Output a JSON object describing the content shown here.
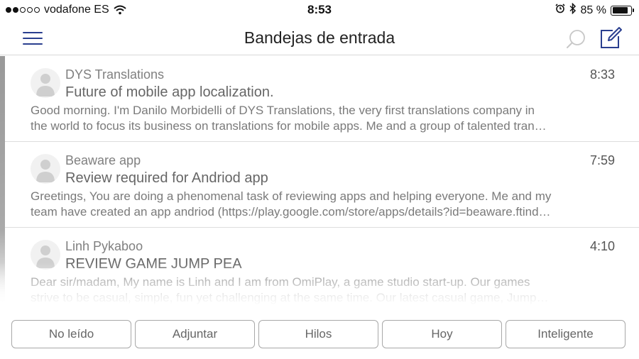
{
  "status_bar": {
    "carrier": "vodafone ES",
    "time": "8:53",
    "battery_percent": "85 %",
    "battery_level": 0.85,
    "signal_bars": 2,
    "signal_total": 5
  },
  "nav": {
    "title": "Bandejas de entrada",
    "menu_icon": "hamburger-menu-icon",
    "search_icon": "search-icon",
    "compose_icon": "compose-icon",
    "accent_color": "#2a3f8f"
  },
  "messages": [
    {
      "sender": "DYS Translations",
      "time": "8:33",
      "subject": "Future of mobile app localization.",
      "preview_line1": "Good morning. I'm Danilo Morbidelli of DYS Translations, the very first translations company in",
      "preview_line2": "the world to focus its business on translations for mobile apps. Me and a group of talented tran…"
    },
    {
      "sender": "Beaware app",
      "time": "7:59",
      "subject": "Review required for Andriod app",
      "preview_line1": "Greetings, You are doing a phenomenal task of reviewing apps and helping everyone. Me and my",
      "preview_line2": "team have created an app andriod (https://play.google.com/store/apps/details?id=beaware.ftind…"
    },
    {
      "sender": "Linh Pykaboo",
      "time": "4:10",
      "subject": "REVIEW GAME JUMP PEA",
      "preview_line1": "Dear sir/madam, My name is Linh and I am from OmiPlay, a game studio start-up. Our games",
      "preview_line2": "strive to be casual, simple, fun yet challenging at the same time. Our latest casual game, Jump…"
    }
  ],
  "filters": [
    {
      "label": "No leído"
    },
    {
      "label": "Adjuntar"
    },
    {
      "label": "Hilos"
    },
    {
      "label": "Hoy"
    },
    {
      "label": "Inteligente"
    }
  ]
}
